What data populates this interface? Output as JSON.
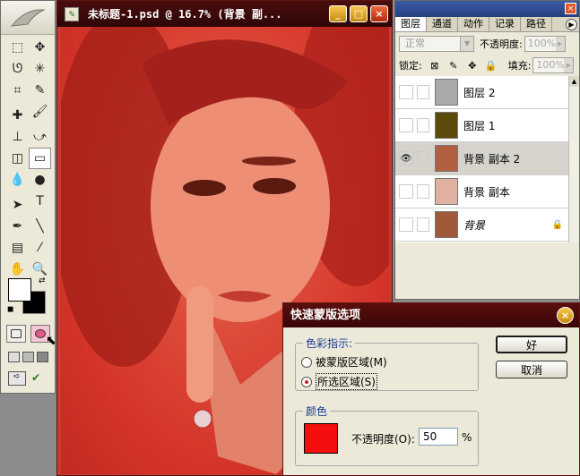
{
  "document": {
    "title": "未标题-1.psd @ 16.7% (背景 副...",
    "min_label": "_",
    "max_label": "□",
    "close_label": "×"
  },
  "toolbox": {
    "tools": [
      "marquee-icon",
      "move-icon",
      "lasso-icon",
      "magic-wand-icon",
      "crop-icon",
      "slice-icon",
      "healing-icon",
      "brush-icon",
      "stamp-icon",
      "history-brush-icon",
      "eraser-icon",
      "gradient-icon",
      "blur-icon",
      "dodge-icon",
      "path-select-icon",
      "type-icon",
      "pen-icon",
      "line-icon",
      "notes-icon",
      "eyedropper-icon",
      "hand-icon",
      "zoom-icon"
    ],
    "glyphs": [
      "⬚",
      "✥",
      "ᘎ",
      "✳",
      "⌗",
      "✎",
      "✚",
      "🖌",
      "⊥",
      "⤻",
      "◫",
      "▭",
      "💧",
      "●",
      "➤",
      "T",
      "✒",
      "╲",
      "▤",
      "⁄",
      "✋",
      "🔍"
    ]
  },
  "layers_panel": {
    "tabs": [
      "图层",
      "通道",
      "动作",
      "记录",
      "路径"
    ],
    "tab_arrow": "▶",
    "blend_mode": "正常",
    "opacity_label": "不透明度:",
    "opacity_value": "100%",
    "lock_label": "锁定:",
    "fill_label": "填充:",
    "fill_value": "100%",
    "layers": [
      {
        "name": "图层 2",
        "visible": false,
        "thumb": "#a9a9a9",
        "selected": false
      },
      {
        "name": "图层 1",
        "visible": false,
        "thumb": "#5c4a0a",
        "selected": false
      },
      {
        "name": "背景 副本 2",
        "visible": true,
        "thumb": "#b06040",
        "selected": true
      },
      {
        "name": "背景 副本",
        "visible": false,
        "thumb": "#e0b0a0",
        "selected": false
      },
      {
        "name": "背景",
        "visible": false,
        "thumb": "#a05a3a",
        "selected": false
      }
    ]
  },
  "dialog": {
    "title": "快速蒙版选项",
    "color_indicates_legend": "色彩指示:",
    "option_masked": "被蒙版区域(M)",
    "option_selected": "所选区域(S)",
    "color_legend": "颜色",
    "opacity_label": "不透明度(O):",
    "opacity_value": "50",
    "percent": "%",
    "ok_label": "好",
    "cancel_label": "取消",
    "mask_color": "#f50e0e"
  }
}
